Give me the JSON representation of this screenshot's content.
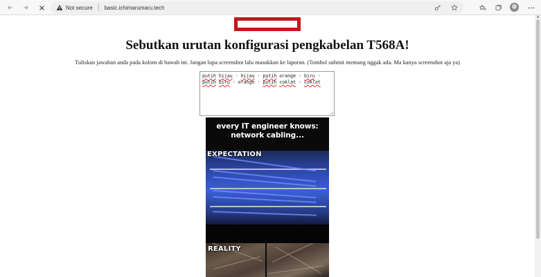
{
  "browser": {
    "security_label": "Not secure",
    "url": "basic.ichimarumaru.tech",
    "icons": [
      "back-arrow-icon",
      "forward-arrow-icon",
      "stop-icon",
      "warning-icon",
      "key-icon",
      "favorite-star-icon",
      "favorites-icon",
      "collections-icon",
      "downloads-icon",
      "profile-avatar",
      "more-menu-icon"
    ]
  },
  "page": {
    "heading": "Sebutkan urutan konfigurasi pengkabelan T568A!",
    "instructions": "Tuliskan jawaban anda pada kolom di bawah ini. Jangan lupa screenshot lalu masukkan ke laporan. (Tombol submit memang nggak ada. Ma kanya screenshot aja ya)",
    "answer_tokens": [
      {
        "text": "putih",
        "spell": true
      },
      {
        "text": " ",
        "spell": false
      },
      {
        "text": "hijau",
        "spell": true
      },
      {
        "text": " - ",
        "spell": false
      },
      {
        "text": "hijau",
        "spell": true
      },
      {
        "text": " - ",
        "spell": false
      },
      {
        "text": "putih",
        "spell": true
      },
      {
        "text": " orange - ",
        "spell": false
      },
      {
        "text": "biru",
        "spell": true
      },
      {
        "text": " - ",
        "spell": false
      },
      {
        "text": "putih",
        "spell": true
      },
      {
        "text": " ",
        "spell": false
      },
      {
        "text": "biru",
        "spell": true
      },
      {
        "text": " - orange - ",
        "spell": false
      },
      {
        "text": "putih",
        "spell": true
      },
      {
        "text": " ",
        "spell": false
      },
      {
        "text": "coklat",
        "spell": true
      },
      {
        "text": " - ",
        "spell": false
      },
      {
        "text": "coklat",
        "spell": true
      }
    ],
    "meme": {
      "top_text": "every IT engineer knows: network cabling...",
      "label_expectation": "EXPECTATION",
      "label_reality": "REALITY"
    }
  },
  "colors": {
    "banner_border": "#c4161c",
    "spellcheck_underline": "#d33"
  }
}
